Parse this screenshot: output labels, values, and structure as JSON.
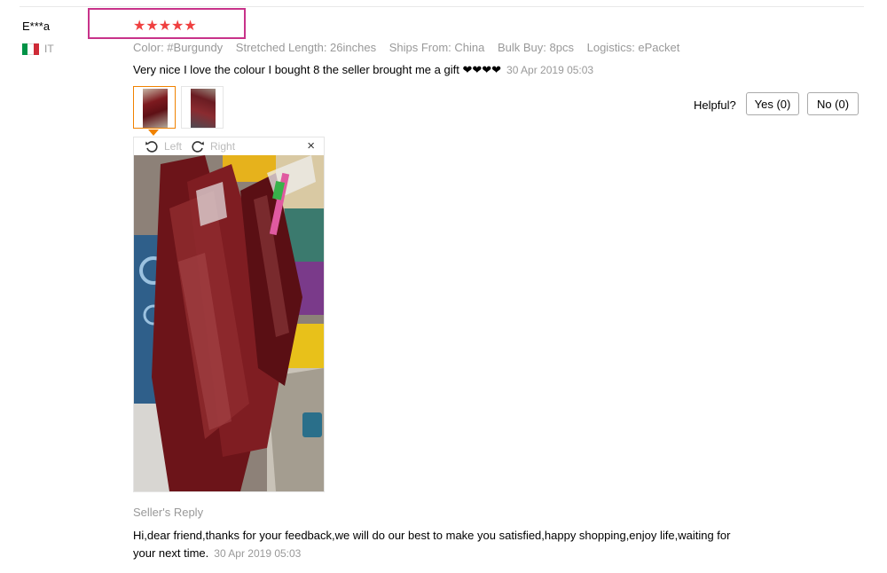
{
  "reviewer": {
    "name": "E***a",
    "country": "IT",
    "flag_colors": [
      "#009246",
      "#ffffff",
      "#ce2b37"
    ]
  },
  "rating": {
    "stars": 5,
    "max": 5,
    "glyphs": "★★★★★",
    "color": "#ef4040"
  },
  "attributes": [
    "Color: #Burgundy",
    "Stretched Length: 26inches",
    "Ships From: China",
    "Bulk Buy: 8pcs",
    "Logistics: ePacket"
  ],
  "review": {
    "text": "Very nice I love the colour I bought 8 the seller brought me a gift ❤❤❤❤",
    "date": "30 Apr 2019 05:03"
  },
  "thumbnails": [
    {
      "name": "photo-1",
      "active": true
    },
    {
      "name": "photo-2",
      "active": false
    }
  ],
  "helpful": {
    "label": "Helpful?",
    "yes_label": "Yes (0)",
    "no_label": "No (0)"
  },
  "viewer": {
    "rotate_left_label": "Left",
    "rotate_right_label": "Right",
    "close_label": "×"
  },
  "seller_reply": {
    "label": "Seller's Reply",
    "text": "Hi,dear friend,thanks for your feedback,we will do our best to make you satisfied,happy shopping,enjoy life,waiting for your next time.",
    "date": "30 Apr 2019 05:03"
  },
  "colors": {
    "highlight_box": "#c8338a",
    "active_thumb": "#f08200"
  }
}
